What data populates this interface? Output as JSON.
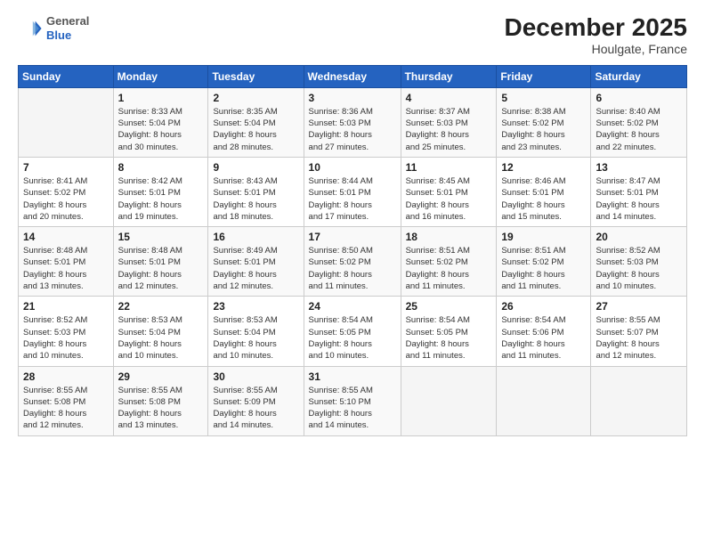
{
  "header": {
    "logo_general": "General",
    "logo_blue": "Blue",
    "month_title": "December 2025",
    "location": "Houlgate, France"
  },
  "days_of_week": [
    "Sunday",
    "Monday",
    "Tuesday",
    "Wednesday",
    "Thursday",
    "Friday",
    "Saturday"
  ],
  "weeks": [
    [
      {
        "day": "",
        "info": ""
      },
      {
        "day": "1",
        "info": "Sunrise: 8:33 AM\nSunset: 5:04 PM\nDaylight: 8 hours\nand 30 minutes."
      },
      {
        "day": "2",
        "info": "Sunrise: 8:35 AM\nSunset: 5:04 PM\nDaylight: 8 hours\nand 28 minutes."
      },
      {
        "day": "3",
        "info": "Sunrise: 8:36 AM\nSunset: 5:03 PM\nDaylight: 8 hours\nand 27 minutes."
      },
      {
        "day": "4",
        "info": "Sunrise: 8:37 AM\nSunset: 5:03 PM\nDaylight: 8 hours\nand 25 minutes."
      },
      {
        "day": "5",
        "info": "Sunrise: 8:38 AM\nSunset: 5:02 PM\nDaylight: 8 hours\nand 23 minutes."
      },
      {
        "day": "6",
        "info": "Sunrise: 8:40 AM\nSunset: 5:02 PM\nDaylight: 8 hours\nand 22 minutes."
      }
    ],
    [
      {
        "day": "7",
        "info": "Sunrise: 8:41 AM\nSunset: 5:02 PM\nDaylight: 8 hours\nand 20 minutes."
      },
      {
        "day": "8",
        "info": "Sunrise: 8:42 AM\nSunset: 5:01 PM\nDaylight: 8 hours\nand 19 minutes."
      },
      {
        "day": "9",
        "info": "Sunrise: 8:43 AM\nSunset: 5:01 PM\nDaylight: 8 hours\nand 18 minutes."
      },
      {
        "day": "10",
        "info": "Sunrise: 8:44 AM\nSunset: 5:01 PM\nDaylight: 8 hours\nand 17 minutes."
      },
      {
        "day": "11",
        "info": "Sunrise: 8:45 AM\nSunset: 5:01 PM\nDaylight: 8 hours\nand 16 minutes."
      },
      {
        "day": "12",
        "info": "Sunrise: 8:46 AM\nSunset: 5:01 PM\nDaylight: 8 hours\nand 15 minutes."
      },
      {
        "day": "13",
        "info": "Sunrise: 8:47 AM\nSunset: 5:01 PM\nDaylight: 8 hours\nand 14 minutes."
      }
    ],
    [
      {
        "day": "14",
        "info": "Sunrise: 8:48 AM\nSunset: 5:01 PM\nDaylight: 8 hours\nand 13 minutes."
      },
      {
        "day": "15",
        "info": "Sunrise: 8:48 AM\nSunset: 5:01 PM\nDaylight: 8 hours\nand 12 minutes."
      },
      {
        "day": "16",
        "info": "Sunrise: 8:49 AM\nSunset: 5:01 PM\nDaylight: 8 hours\nand 12 minutes."
      },
      {
        "day": "17",
        "info": "Sunrise: 8:50 AM\nSunset: 5:02 PM\nDaylight: 8 hours\nand 11 minutes."
      },
      {
        "day": "18",
        "info": "Sunrise: 8:51 AM\nSunset: 5:02 PM\nDaylight: 8 hours\nand 11 minutes."
      },
      {
        "day": "19",
        "info": "Sunrise: 8:51 AM\nSunset: 5:02 PM\nDaylight: 8 hours\nand 11 minutes."
      },
      {
        "day": "20",
        "info": "Sunrise: 8:52 AM\nSunset: 5:03 PM\nDaylight: 8 hours\nand 10 minutes."
      }
    ],
    [
      {
        "day": "21",
        "info": "Sunrise: 8:52 AM\nSunset: 5:03 PM\nDaylight: 8 hours\nand 10 minutes."
      },
      {
        "day": "22",
        "info": "Sunrise: 8:53 AM\nSunset: 5:04 PM\nDaylight: 8 hours\nand 10 minutes."
      },
      {
        "day": "23",
        "info": "Sunrise: 8:53 AM\nSunset: 5:04 PM\nDaylight: 8 hours\nand 10 minutes."
      },
      {
        "day": "24",
        "info": "Sunrise: 8:54 AM\nSunset: 5:05 PM\nDaylight: 8 hours\nand 10 minutes."
      },
      {
        "day": "25",
        "info": "Sunrise: 8:54 AM\nSunset: 5:05 PM\nDaylight: 8 hours\nand 11 minutes."
      },
      {
        "day": "26",
        "info": "Sunrise: 8:54 AM\nSunset: 5:06 PM\nDaylight: 8 hours\nand 11 minutes."
      },
      {
        "day": "27",
        "info": "Sunrise: 8:55 AM\nSunset: 5:07 PM\nDaylight: 8 hours\nand 12 minutes."
      }
    ],
    [
      {
        "day": "28",
        "info": "Sunrise: 8:55 AM\nSunset: 5:08 PM\nDaylight: 8 hours\nand 12 minutes."
      },
      {
        "day": "29",
        "info": "Sunrise: 8:55 AM\nSunset: 5:08 PM\nDaylight: 8 hours\nand 13 minutes."
      },
      {
        "day": "30",
        "info": "Sunrise: 8:55 AM\nSunset: 5:09 PM\nDaylight: 8 hours\nand 14 minutes."
      },
      {
        "day": "31",
        "info": "Sunrise: 8:55 AM\nSunset: 5:10 PM\nDaylight: 8 hours\nand 14 minutes."
      },
      {
        "day": "",
        "info": ""
      },
      {
        "day": "",
        "info": ""
      },
      {
        "day": "",
        "info": ""
      }
    ]
  ]
}
